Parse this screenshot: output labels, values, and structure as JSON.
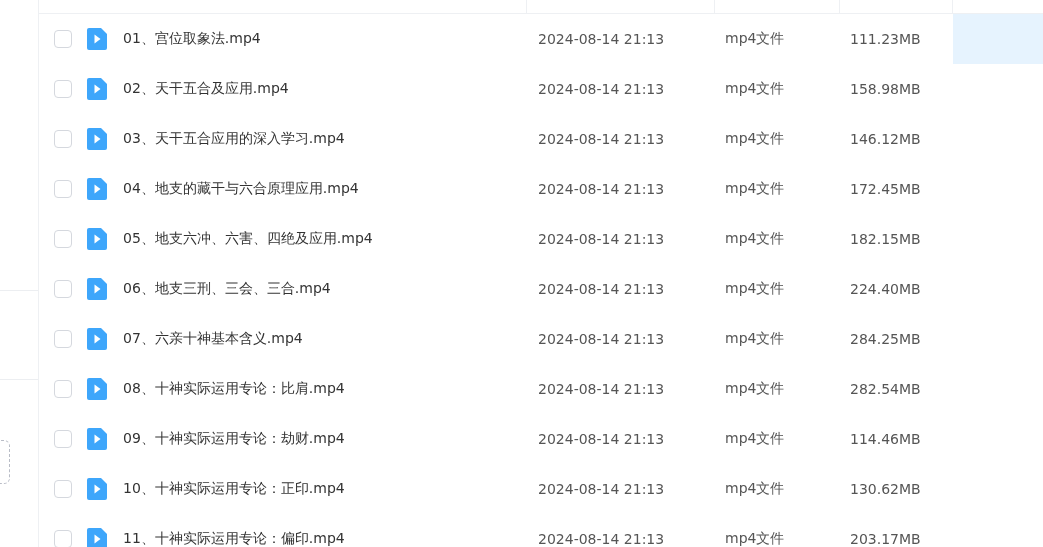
{
  "files": [
    {
      "name": "01、宫位取象法.mp4",
      "modified": "2024-08-14 21:13",
      "type": "mp4文件",
      "size": "111.23MB",
      "checked": false,
      "highlighted": true
    },
    {
      "name": "02、天干五合及应用.mp4",
      "modified": "2024-08-14 21:13",
      "type": "mp4文件",
      "size": "158.98MB",
      "checked": false,
      "highlighted": false
    },
    {
      "name": "03、天干五合应用的深入学习.mp4",
      "modified": "2024-08-14 21:13",
      "type": "mp4文件",
      "size": "146.12MB",
      "checked": false,
      "highlighted": false
    },
    {
      "name": "04、地支的藏干与六合原理应用.mp4",
      "modified": "2024-08-14 21:13",
      "type": "mp4文件",
      "size": "172.45MB",
      "checked": false,
      "highlighted": false
    },
    {
      "name": "05、地支六冲、六害、四绝及应用.mp4",
      "modified": "2024-08-14 21:13",
      "type": "mp4文件",
      "size": "182.15MB",
      "checked": false,
      "highlighted": false
    },
    {
      "name": "06、地支三刑、三会、三合.mp4",
      "modified": "2024-08-14 21:13",
      "type": "mp4文件",
      "size": "224.40MB",
      "checked": false,
      "highlighted": false
    },
    {
      "name": "07、六亲十神基本含义.mp4",
      "modified": "2024-08-14 21:13",
      "type": "mp4文件",
      "size": "284.25MB",
      "checked": false,
      "highlighted": false
    },
    {
      "name": "08、十神实际运用专论：比肩.mp4",
      "modified": "2024-08-14 21:13",
      "type": "mp4文件",
      "size": "282.54MB",
      "checked": false,
      "highlighted": false
    },
    {
      "name": "09、十神实际运用专论：劫财.mp4",
      "modified": "2024-08-14 21:13",
      "type": "mp4文件",
      "size": "114.46MB",
      "checked": false,
      "highlighted": false
    },
    {
      "name": "10、十神实际运用专论：正印.mp4",
      "modified": "2024-08-14 21:13",
      "type": "mp4文件",
      "size": "130.62MB",
      "checked": false,
      "highlighted": false
    },
    {
      "name": "11、十神实际运用专论：偏印.mp4",
      "modified": "2024-08-14 21:13",
      "type": "mp4文件",
      "size": "203.17MB",
      "checked": false,
      "highlighted": false
    }
  ]
}
